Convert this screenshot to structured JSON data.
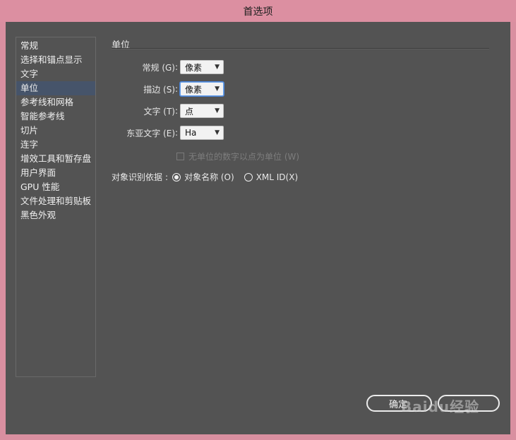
{
  "window": {
    "title": "首选项"
  },
  "sidebar": {
    "items": [
      {
        "label": "常规"
      },
      {
        "label": "选择和锚点显示"
      },
      {
        "label": "文字"
      },
      {
        "label": "单位",
        "selected": true
      },
      {
        "label": "参考线和网格"
      },
      {
        "label": "智能参考线"
      },
      {
        "label": "切片"
      },
      {
        "label": "连字"
      },
      {
        "label": "增效工具和暂存盘"
      },
      {
        "label": "用户界面"
      },
      {
        "label": "GPU 性能"
      },
      {
        "label": "文件处理和剪贴板"
      },
      {
        "label": "黑色外观"
      }
    ]
  },
  "units": {
    "section_title": "单位",
    "general": {
      "label": "常规 (G)",
      "value": "像素"
    },
    "stroke": {
      "label": "描边 (S)",
      "value": "像素"
    },
    "type": {
      "label": "文字 (T)",
      "value": "点"
    },
    "asian_type": {
      "label": "东亚文字 (E)",
      "value": "Ha"
    },
    "numbers_checkbox": {
      "label": "无单位的数字以点为单位 (W)",
      "checked": false,
      "enabled": false
    },
    "identify_by": {
      "label": "对象识别依据",
      "options": [
        {
          "label": "对象名称 (O)",
          "selected": true
        },
        {
          "label": "XML ID(X)",
          "selected": false
        }
      ]
    }
  },
  "footer": {
    "ok_label": "确定",
    "watermark": "Baidu经验"
  },
  "colors": {
    "accent": "#4c84d6",
    "selected_bg": "#46546a",
    "dialog_bg": "#535353",
    "frame": "#d98fa0"
  }
}
